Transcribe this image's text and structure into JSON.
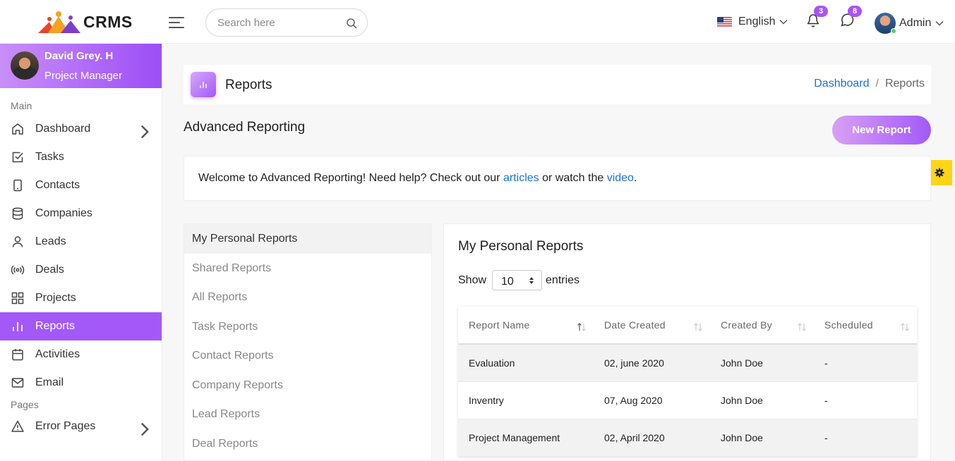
{
  "header": {
    "logo_text": "CRMS",
    "search_placeholder": "Search here",
    "language": "English",
    "notifications_count": "3",
    "messages_count": "8",
    "user_label": "Admin"
  },
  "sidebar": {
    "profile": {
      "name": "David Grey. H",
      "role": "Project Manager"
    },
    "section_main": "Main",
    "items": [
      {
        "label": "Dashboard",
        "icon": "home-icon"
      },
      {
        "label": "Tasks",
        "icon": "check-square-icon"
      },
      {
        "label": "Contacts",
        "icon": "phone-icon"
      },
      {
        "label": "Companies",
        "icon": "database-icon"
      },
      {
        "label": "Leads",
        "icon": "user-icon"
      },
      {
        "label": "Deals",
        "icon": "broadcast-icon"
      },
      {
        "label": "Projects",
        "icon": "grid-icon"
      },
      {
        "label": "Reports",
        "icon": "bar-chart-icon"
      },
      {
        "label": "Activities",
        "icon": "calendar-icon"
      },
      {
        "label": "Email",
        "icon": "mail-icon"
      }
    ],
    "section_pages": "Pages",
    "pages_items": [
      {
        "label": "Error Pages",
        "icon": "alert-triangle-icon"
      }
    ]
  },
  "page": {
    "title": "Reports",
    "breadcrumb": {
      "link": "Dashboard",
      "separator": "/",
      "current": "Reports"
    },
    "section_heading": "Advanced Reporting",
    "new_report_label": "New Report",
    "welcome": {
      "text_before": "Welcome to Advanced Reporting! Need help? Check out our ",
      "articles_link": "articles",
      "text_middle": " or watch the ",
      "video_link": "video",
      "text_after": "."
    }
  },
  "report_menu": [
    "My Personal Reports",
    "Shared Reports",
    "All Reports",
    "Task Reports",
    "Contact Reports",
    "Company Reports",
    "Lead Reports",
    "Deal Reports"
  ],
  "report_card": {
    "title": "My Personal Reports",
    "show_label": "Show",
    "entries_value": "10",
    "entries_label": "entries",
    "columns": [
      "Report Name",
      "Date Created",
      "Created By",
      "Scheduled"
    ],
    "rows": [
      [
        "Evaluation",
        "02, june 2020",
        "John Doe",
        "-"
      ],
      [
        "Inventry",
        "07, Aug 2020",
        "John Doe",
        "-"
      ],
      [
        "Project Management",
        "02, April 2020",
        "John Doe",
        "-"
      ]
    ]
  },
  "colors": {
    "accent": "#a259f8",
    "link": "#1a73d8",
    "badge": "#a855f7",
    "settings_fab": "#fed416"
  }
}
